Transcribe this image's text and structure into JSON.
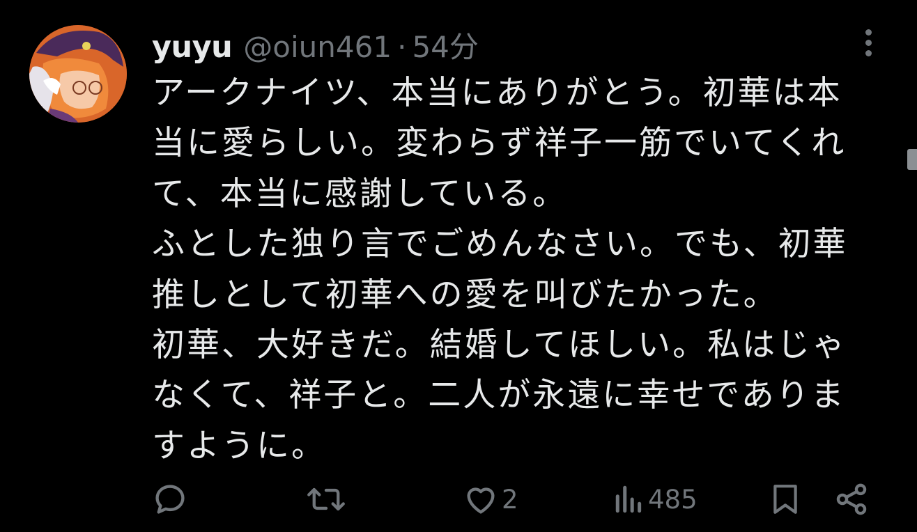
{
  "author": {
    "display_name": "yuyu",
    "handle": "@oiun461",
    "separator": "·",
    "time": "54分"
  },
  "post": {
    "lines": [
      "アークナイツ、本当にありがとう。初華は本",
      "当に愛らしい。変わらず祥子一筋でいてくれ",
      "て、本当に感謝している。",
      "ふとした独り言でごめんなさい。でも、初華",
      "推しとして初華への愛を叫びたかった。",
      "初華、大好きだ。結婚してほしい。私はじゃ",
      "なくて、祥子と。二人が永遠に幸せでありま",
      "すように。"
    ]
  },
  "actions": {
    "reply": {
      "icon": "reply-icon"
    },
    "repost": {
      "icon": "repost-icon"
    },
    "like": {
      "icon": "heart-icon",
      "count": "2"
    },
    "views": {
      "icon": "views-icon",
      "count": "485"
    },
    "bookmark": {
      "icon": "bookmark-icon"
    },
    "share": {
      "icon": "share-icon"
    }
  },
  "colors": {
    "background": "#000000",
    "primary_text": "#e7e9ea",
    "secondary_text": "#71767b"
  }
}
